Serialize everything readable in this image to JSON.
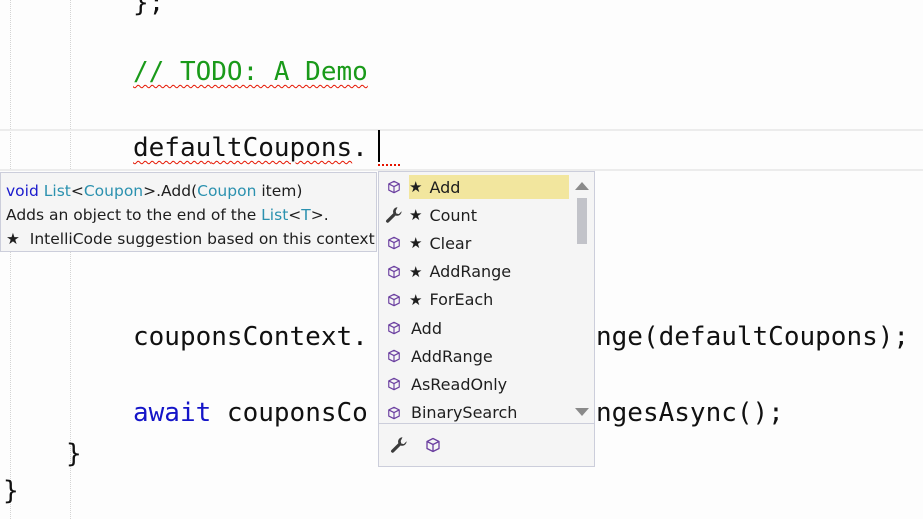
{
  "editor": {
    "top_fragment": "};",
    "comment": "// TODO: A Demo",
    "typed_prefix": "defau",
    "typed_rest": "ltCoupons",
    "typed_dot": ".",
    "line_couponsContext_left": "couponsContext.",
    "line_couponsContext_right": "nge(defaultCoupons);",
    "await_kw": "await",
    "await_left": " couponsCo",
    "await_right": "ngesAsync();",
    "close_brace_inner": "}",
    "close_brace_outer": "}"
  },
  "tooltip": {
    "sig_kw": "void",
    "sig_type1": "List",
    "sig_lt": "<",
    "sig_type2": "Coupon",
    "sig_gt_method": ">.Add(",
    "sig_type3": "Coupon",
    "sig_param": " item)",
    "desc_a": "Adds an object to the end of the ",
    "desc_type": "List",
    "desc_lt": "<",
    "desc_t": "T",
    "desc_end": ">.",
    "intellicode_star": "★",
    "intellicode_text": "IntelliCode suggestion based on this context"
  },
  "completion": {
    "items": [
      {
        "label": "Add",
        "starred": "★",
        "icon": "method-cube-icon",
        "selected": true
      },
      {
        "label": "Count",
        "starred": "★",
        "icon": "property-wrench-icon",
        "selected": false
      },
      {
        "label": "Clear",
        "starred": "★",
        "icon": "method-cube-icon",
        "selected": false
      },
      {
        "label": "AddRange",
        "starred": "★",
        "icon": "method-cube-icon",
        "selected": false
      },
      {
        "label": "ForEach",
        "starred": "★",
        "icon": "method-cube-icon",
        "selected": false
      },
      {
        "label": "Add",
        "starred": "",
        "icon": "method-cube-icon",
        "selected": false
      },
      {
        "label": "AddRange",
        "starred": "",
        "icon": "method-cube-icon",
        "selected": false
      },
      {
        "label": "AsReadOnly",
        "starred": "",
        "icon": "method-cube-icon",
        "selected": false
      },
      {
        "label": "BinarySearch",
        "starred": "",
        "icon": "method-cube-icon",
        "selected": false
      }
    ],
    "filters": [
      "property-filter-wrench-icon",
      "method-filter-cube-icon"
    ]
  },
  "colors": {
    "comment": "#1a9a1a",
    "keyword": "#1515c8",
    "type": "#2b91af",
    "selection": "#f2e69e",
    "icon_purple": "#6b3fa0"
  }
}
